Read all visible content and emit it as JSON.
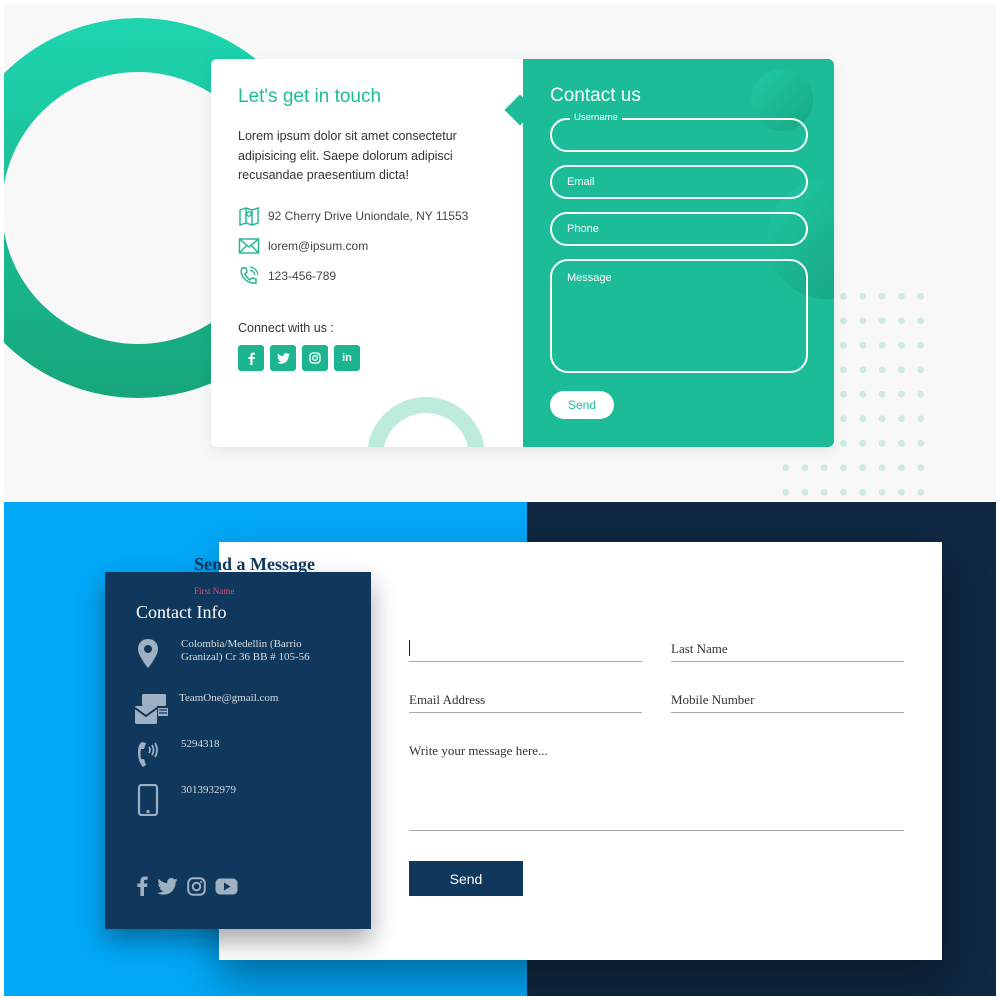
{
  "top": {
    "left": {
      "title": "Let's get in touch",
      "description": "Lorem ipsum dolor sit amet consectetur adipisicing elit. Saepe dolorum adipisci recusandae praesentium dicta!",
      "address": "92 Cherry Drive Uniondale, NY 11553",
      "email": "lorem@ipsum.com",
      "phone": "123-456-789",
      "connect_label": "Connect with us :",
      "socials": [
        "f",
        "t",
        "ig",
        "in"
      ]
    },
    "right": {
      "title": "Contact us",
      "username_label": "Username",
      "email_label": "Email",
      "phone_label": "Phone",
      "message_label": "Message",
      "send_label": "Send"
    },
    "colors": {
      "accent": "#1dbc98",
      "ring": "#1ed5b0"
    }
  },
  "bottom": {
    "info": {
      "title": "Contact Info",
      "address": "Colombia/Medellin (Barrio Granizal) Cr 36 BB # 105-56",
      "email": "TeamOne@gmail.com",
      "phone": "5294318",
      "mobile": "3013932979",
      "socials": [
        "facebook-icon",
        "twitter-icon",
        "instagram-icon",
        "youtube-icon"
      ]
    },
    "form": {
      "title": "Send a Message",
      "first_name_label": "First Name",
      "last_name_label": "Last Name",
      "email_label": "Email Address",
      "mobile_label": "Mobile Number",
      "message_label": "Write your message here...",
      "send_label": "Send"
    },
    "colors": {
      "blue": "#02a7f7",
      "navy": "#0f2741",
      "card": "#0f385c",
      "focus": "#e14a7d"
    }
  }
}
